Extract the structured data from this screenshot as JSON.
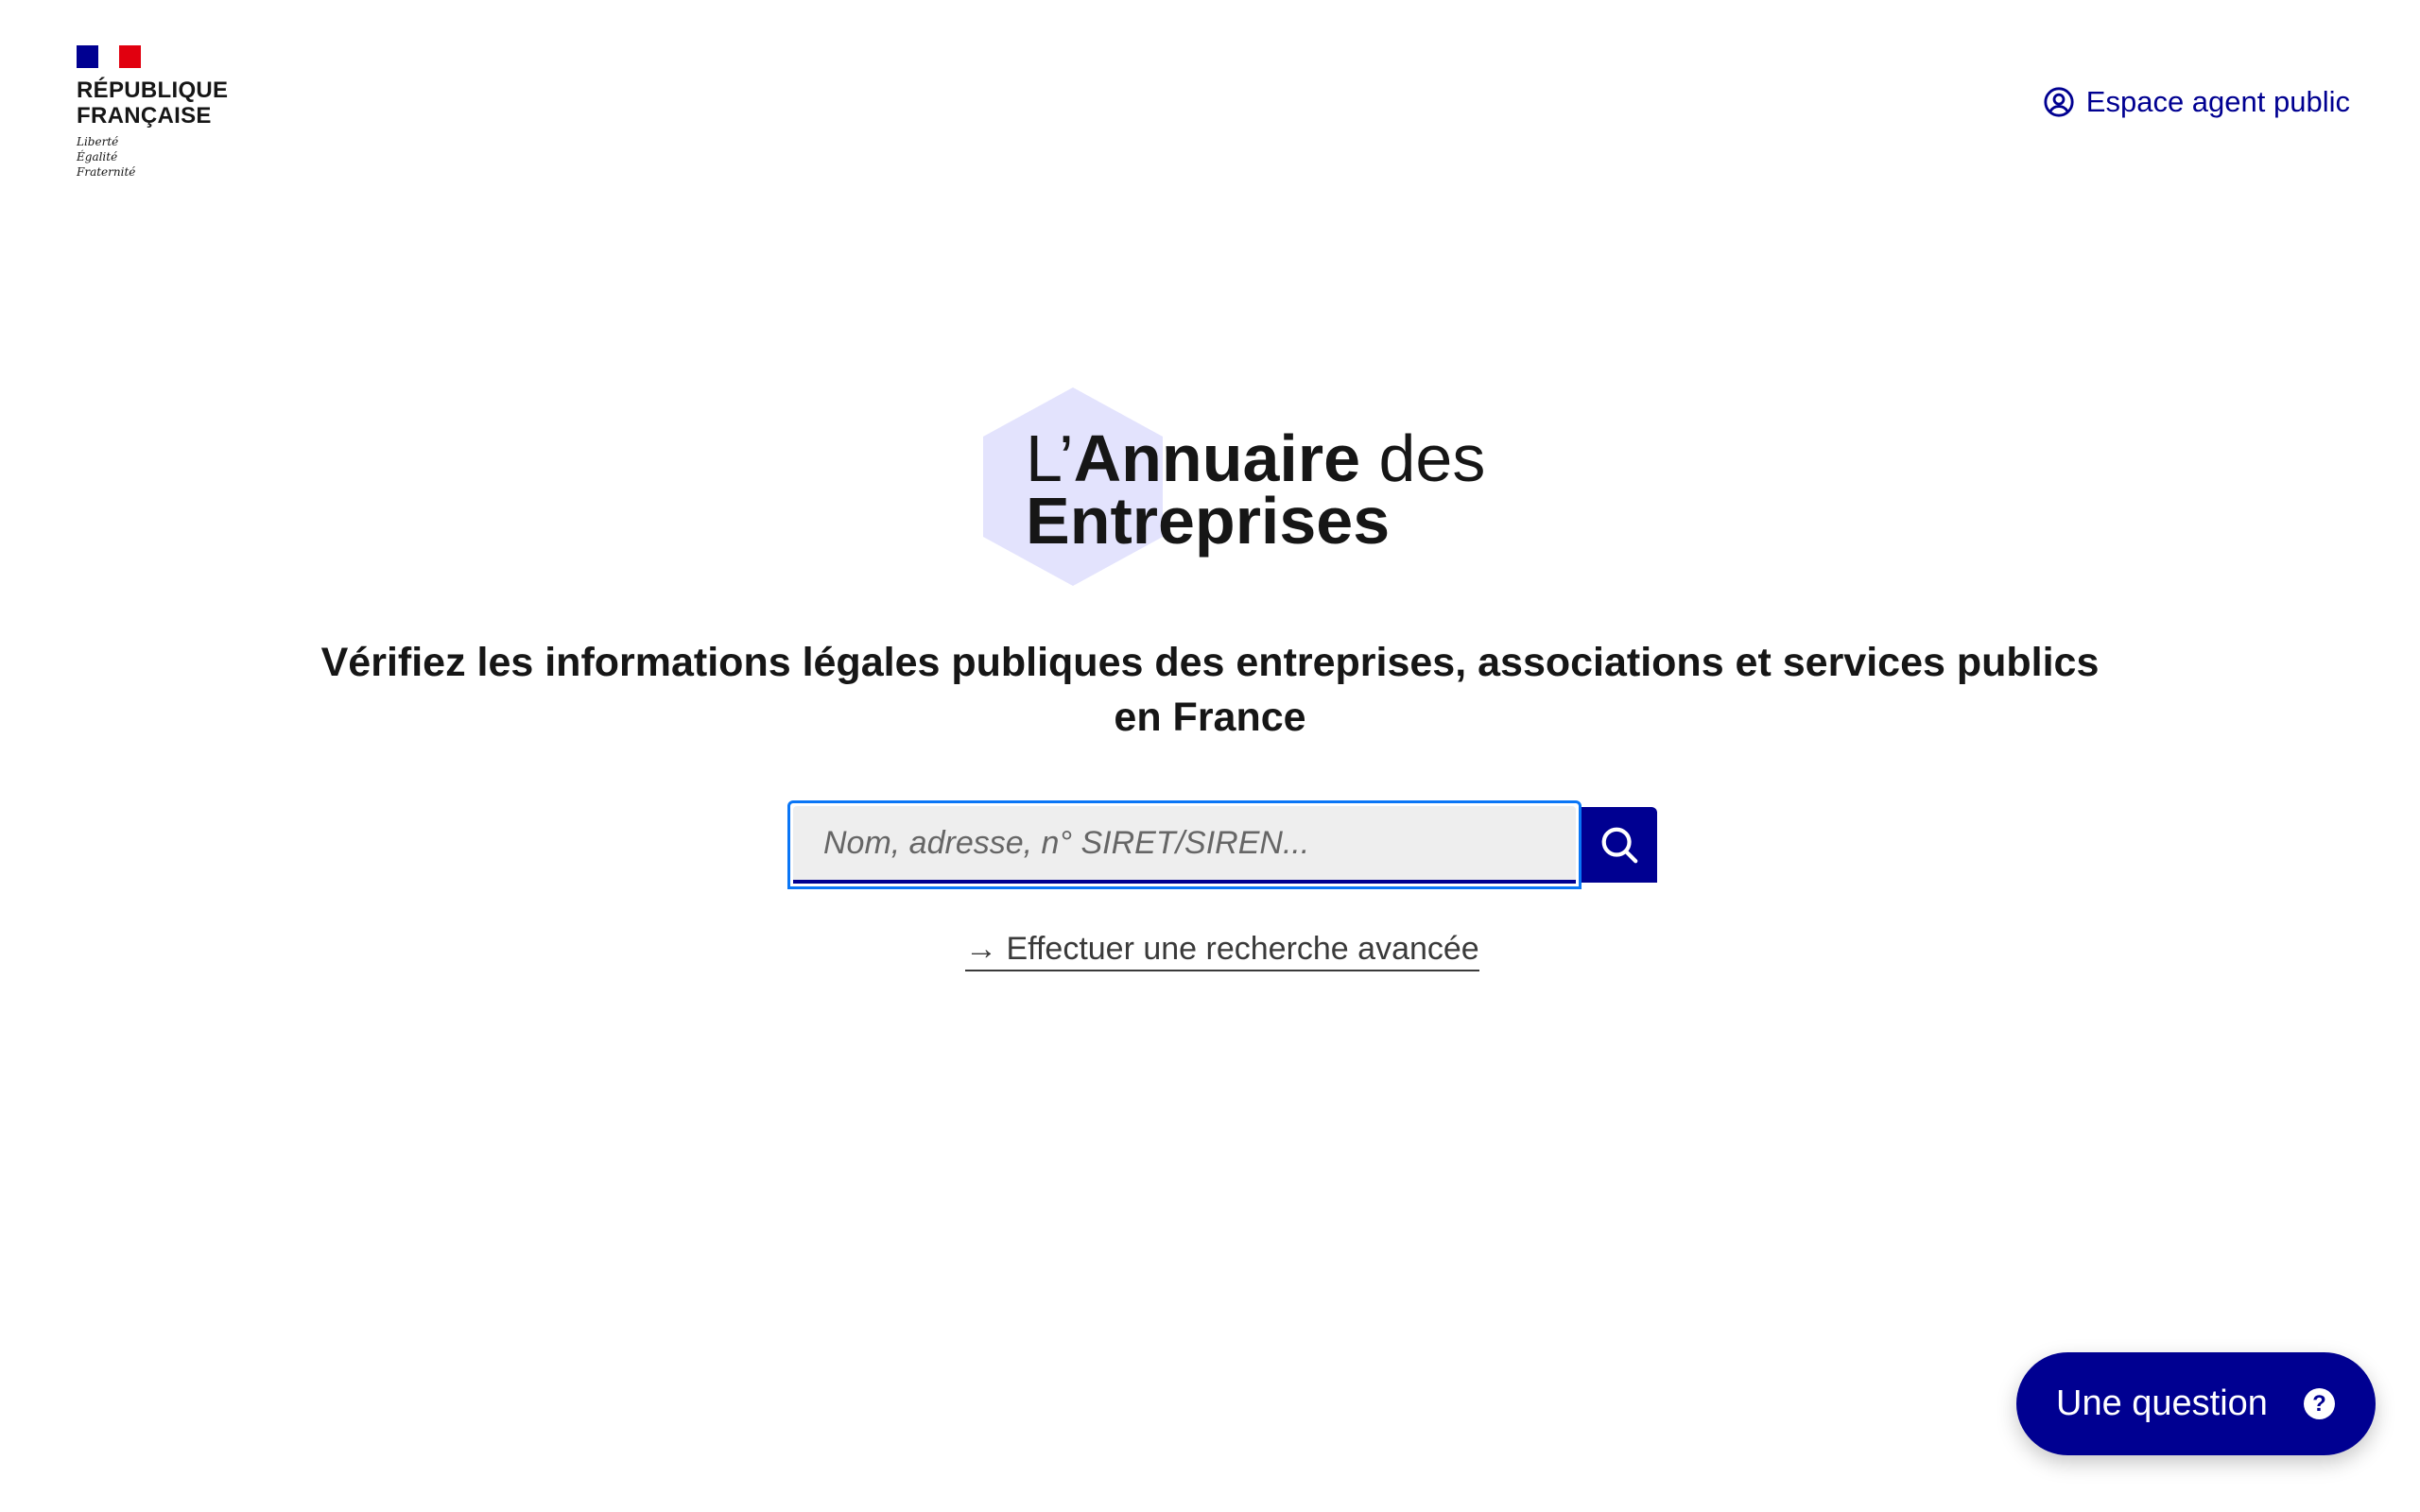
{
  "header": {
    "government": {
      "name": "RÉPUBLIQUE\nFRANÇAISE",
      "motto": "Liberté\nÉgalité\nFraternité"
    },
    "agent_link": {
      "label": "Espace agent public",
      "icon": "user-circle-icon"
    }
  },
  "brand": {
    "prefix": "L’",
    "name_bold": "Annuaire",
    "name_suffix": " des",
    "name_line2": "Entreprises"
  },
  "headline": "Vérifiez les informations légales publiques des entreprises, associations et services publics en France",
  "search": {
    "placeholder": "Nom, adresse, n° SIRET/SIREN...",
    "value": "",
    "button_icon": "search-icon"
  },
  "advanced_search": {
    "arrow": "→",
    "label": "Effectuer une recherche avancée"
  },
  "help_button": {
    "label": "Une question",
    "icon": "question-mark-icon",
    "icon_glyph": "?"
  },
  "colors": {
    "primary": "#000091",
    "focus": "#0a76f6",
    "hexagon": "#e3e3fd",
    "flag_red": "#e1000f"
  }
}
